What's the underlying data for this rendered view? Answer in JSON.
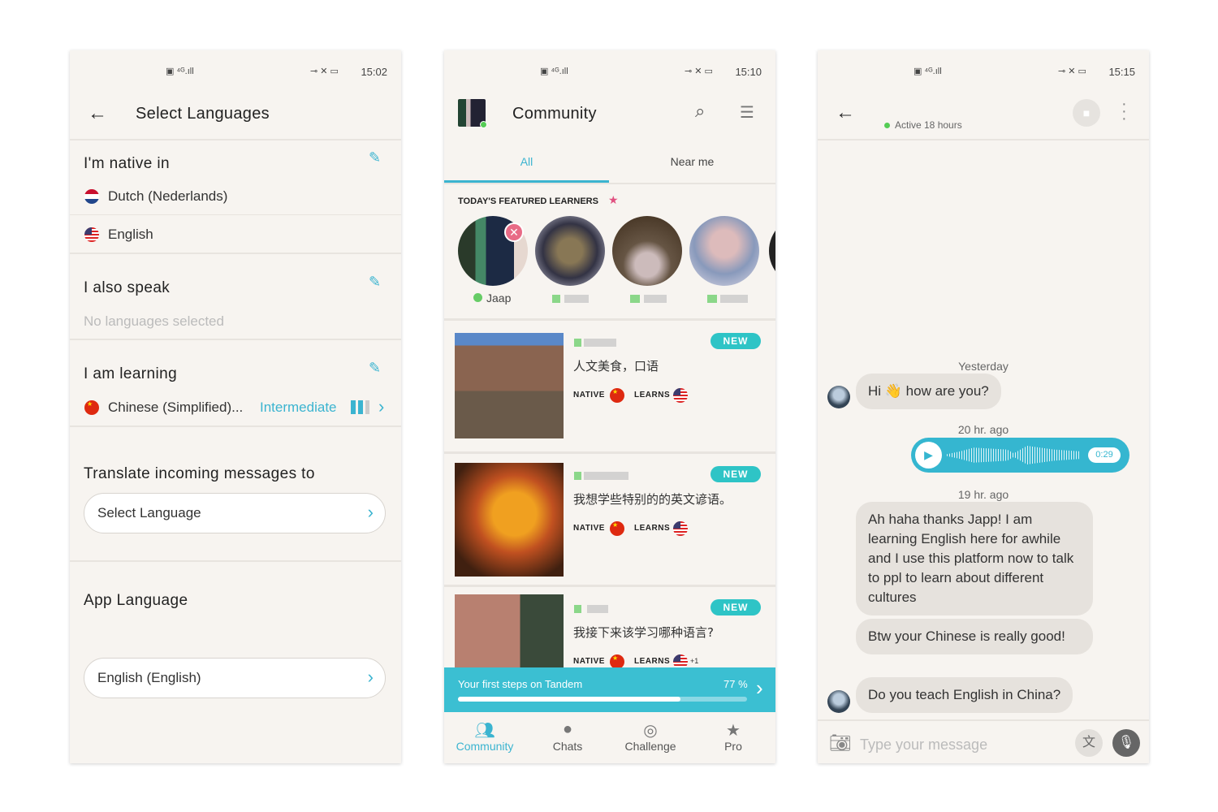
{
  "status_bar": {
    "left_icons": "HD 4G signal",
    "right_icons": "key mute battery"
  },
  "screen1": {
    "time": "15:02",
    "title": "Select Languages",
    "native": {
      "heading": "I'm native in",
      "languages": [
        {
          "name": "Dutch (Nederlands)",
          "flag": "nl"
        },
        {
          "name": "English",
          "flag": "us"
        }
      ]
    },
    "also_speak": {
      "heading": "I also speak",
      "empty": "No languages selected"
    },
    "learning": {
      "heading": "I am learning",
      "language": "Chinese (Simplified)...",
      "level": "Intermediate",
      "level_bars": "2 of 3"
    },
    "translate": {
      "heading": "Translate incoming messages to",
      "value": "Select Language"
    },
    "app_language": {
      "heading": "App Language",
      "value": "English (English)"
    }
  },
  "screen2": {
    "time": "15:10",
    "title": "Community",
    "tabs": [
      {
        "label": "All",
        "active": true
      },
      {
        "label": "Near me",
        "active": false
      }
    ],
    "featured": {
      "heading": "TODAY'S FEATURED LEARNERS",
      "first_name": "Jaap"
    },
    "cards": [
      {
        "badge": "NEW",
        "text": "人文美食，口语",
        "native_label": "NATIVE",
        "learns_label": "LEARNS",
        "extra": ""
      },
      {
        "badge": "NEW",
        "text": "我想学些特别的的英文谚语。",
        "native_label": "NATIVE",
        "learns_label": "LEARNS",
        "extra": ""
      },
      {
        "badge": "NEW",
        "text": "我接下来该学习哪种语言?",
        "native_label": "NATIVE",
        "learns_label": "LEARNS",
        "extra": "+1"
      }
    ],
    "progress": {
      "label": "Your first steps on Tandem",
      "percent_text": "77 %",
      "percent": 77
    },
    "nav": [
      {
        "label": "Community",
        "icon": "community-icon",
        "active": true
      },
      {
        "label": "Chats",
        "icon": "chat-bubble-icon"
      },
      {
        "label": "Challenge",
        "icon": "medal-icon"
      },
      {
        "label": "Pro",
        "icon": "star-icon"
      }
    ]
  },
  "screen3": {
    "time": "15:15",
    "status": "Active 18 hours",
    "messages": [
      {
        "timestamp": "Yesterday",
        "text": "Hi 👋 how are you?",
        "from": "them"
      },
      {
        "timestamp": "20 hr. ago",
        "type": "voice",
        "duration": "0:29",
        "from": "me"
      },
      {
        "timestamp": "19 hr. ago",
        "text": "Ah haha thanks Japp! I am learning English here for awhile and I use this platform now to talk to ppl to learn about different cultures",
        "from": "them"
      },
      {
        "text": "Btw your Chinese is really good!",
        "from": "them"
      },
      {
        "text": "Do you teach English in China?",
        "from": "them"
      }
    ],
    "input_placeholder": "Type your message"
  },
  "colors": {
    "accent": "#3bb4d0",
    "banner": "#3bbfd2",
    "badge": "#2ec4c6",
    "background": "#f7f4f0"
  }
}
